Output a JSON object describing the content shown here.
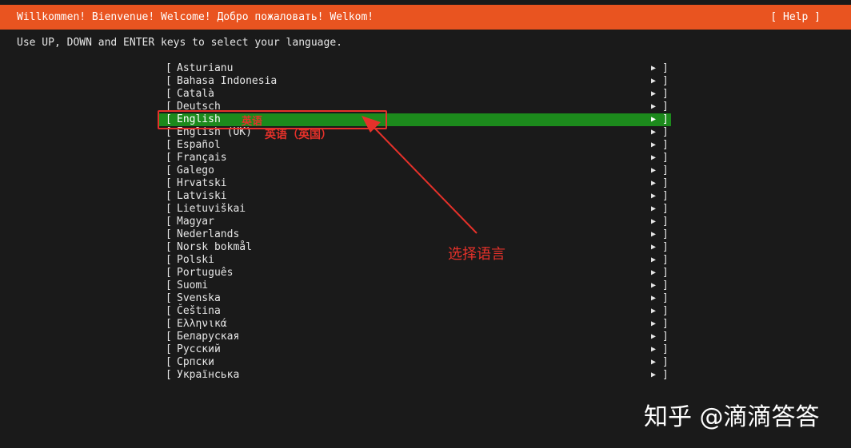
{
  "header": {
    "title": "Willkommen! Bienvenue! Welcome! Добро пожаловать! Welkom!",
    "help_label": "[ Help ]"
  },
  "instructions": "Use UP, DOWN and ENTER keys to select your language.",
  "languages": [
    {
      "label": "Asturianu"
    },
    {
      "label": "Bahasa Indonesia"
    },
    {
      "label": "Català"
    },
    {
      "label": "Deutsch"
    },
    {
      "label": "English",
      "selected": true
    },
    {
      "label": "English (UK)"
    },
    {
      "label": "Español"
    },
    {
      "label": "Français"
    },
    {
      "label": "Galego"
    },
    {
      "label": "Hrvatski"
    },
    {
      "label": "Latviski"
    },
    {
      "label": "Lietuviškai"
    },
    {
      "label": "Magyar"
    },
    {
      "label": "Nederlands"
    },
    {
      "label": "Norsk bokmål"
    },
    {
      "label": "Polski"
    },
    {
      "label": "Português"
    },
    {
      "label": "Suomi"
    },
    {
      "label": "Svenska"
    },
    {
      "label": "Čeština"
    },
    {
      "label": "Ελληνικά"
    },
    {
      "label": "Беларуская"
    },
    {
      "label": "Русский"
    },
    {
      "label": "Српски"
    },
    {
      "label": "Українська"
    }
  ],
  "row_glyphs": {
    "left_bracket": "[",
    "right_bracket": "]",
    "arrow": "▶"
  },
  "annotations": {
    "english": "英语",
    "english_uk": "英语（英国）",
    "select_language": "选择语言"
  },
  "watermark": "知乎 @滴滴答答",
  "colors": {
    "header_bg": "#e95420",
    "selected_bg": "#1c8a1c",
    "annotation": "#e5312a",
    "background": "#1a1a1a"
  }
}
